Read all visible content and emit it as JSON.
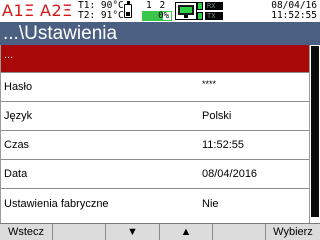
{
  "status_bar": {
    "alarm_1": "A1Ξ",
    "alarm_2": "A2Ξ",
    "t1": "T1: 90°C",
    "t2": "T2: 91°C",
    "channels": "1 2",
    "progress_text": "0%",
    "progress_value": 0.72,
    "rx_label": "RX",
    "tx_label": "TX",
    "date": "08/04/16",
    "time": "11:52:55",
    "alarm_color": "#d41616",
    "indicator_color": "#2fcf46",
    "network_icon": "network-icon",
    "battery_icon": "battery-icon"
  },
  "header": {
    "title": "...\\Ustawienia",
    "background_color": "#4a5f82"
  },
  "menu": {
    "selected_color": "#a80808",
    "back": {
      "label": "..."
    },
    "items": [
      {
        "label": "Hasło",
        "value": "****"
      },
      {
        "label": "Język",
        "value": "Polski"
      },
      {
        "label": "Czas",
        "value": "11:52:55"
      },
      {
        "label": "Data",
        "value": "08/04/2016"
      },
      {
        "label": "Ustawienia fabryczne",
        "value": "Nie"
      }
    ]
  },
  "function_keys": {
    "f1": "Wstecz",
    "f2": "",
    "f3": "▼",
    "f4": "▲",
    "f5": "",
    "f6": "Wybierz"
  }
}
